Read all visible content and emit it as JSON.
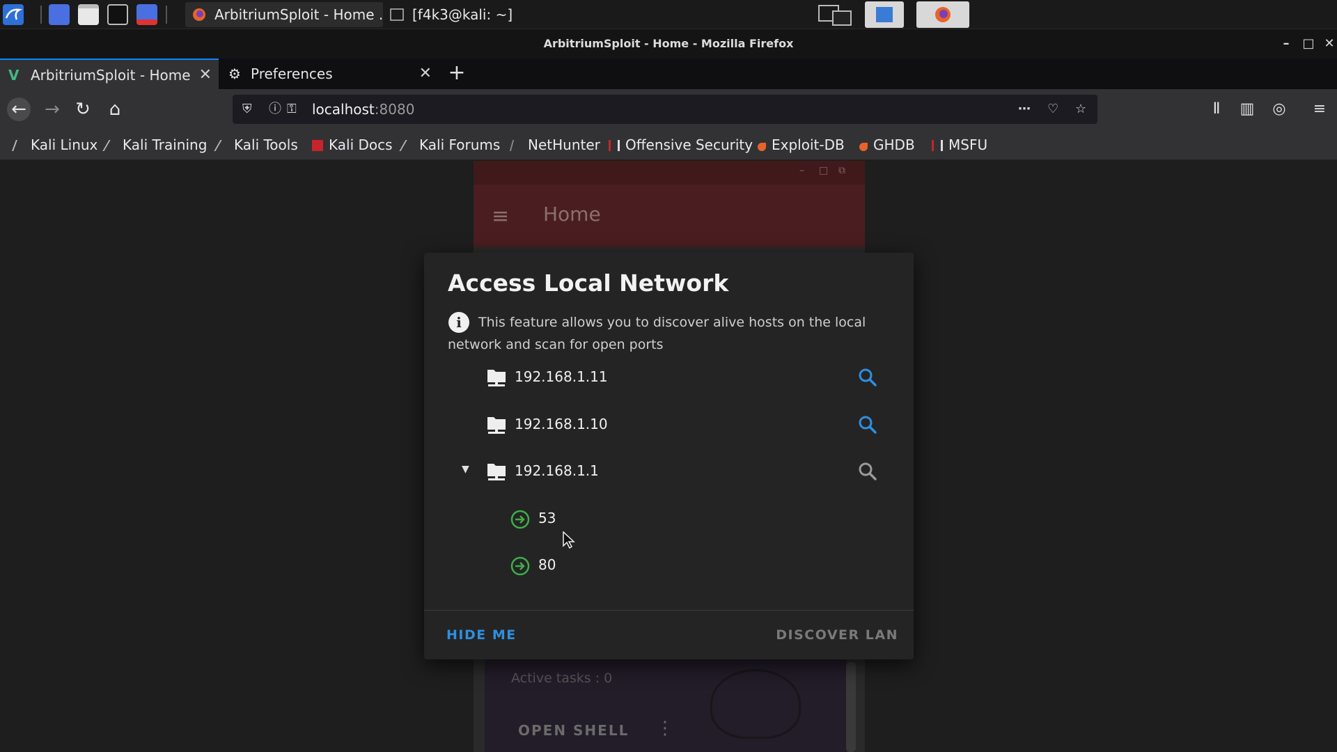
{
  "taskbar": {
    "tasks": [
      {
        "label": "ArbitriumSploit - Home ..."
      },
      {
        "label": "[f4k3@kali: ~]"
      }
    ]
  },
  "window": {
    "title": "ArbitriumSploit - Home - Mozilla Firefox"
  },
  "tabs": [
    {
      "label": "ArbitriumSploit - Home",
      "icon": "v-logo-icon",
      "active": true
    },
    {
      "label": "Preferences",
      "icon": "gear-icon",
      "active": false
    }
  ],
  "urlbar": {
    "host": "localhost",
    "port": ":8080"
  },
  "bookmarks": [
    {
      "label": "Kali Linux",
      "icon": "kali-dragon-icon"
    },
    {
      "label": "Kali Training",
      "icon": "kali-dragon-icon"
    },
    {
      "label": "Kali Tools",
      "icon": "kali-dragon-icon"
    },
    {
      "label": "Kali Docs",
      "icon": "kali-docs-icon"
    },
    {
      "label": "Kali Forums",
      "icon": "kali-dragon-icon"
    },
    {
      "label": "NetHunter",
      "icon": "nethunter-icon"
    },
    {
      "label": "Offensive Security",
      "icon": "offsec-icon"
    },
    {
      "label": "Exploit-DB",
      "icon": "exploitdb-icon"
    },
    {
      "label": "GHDB",
      "icon": "ghdb-icon"
    },
    {
      "label": "MSFU",
      "icon": "offsec-icon"
    }
  ],
  "background_app": {
    "header_title": "Home",
    "active_tasks": "Active tasks : 0",
    "open_shell": "OPEN SHELL"
  },
  "dialog": {
    "title": "Access Local Network",
    "description": "This feature allows you to discover alive hosts on the local network and scan for open ports",
    "hosts": [
      {
        "ip": "192.168.1.11",
        "expanded": false,
        "scan_color": "#2f8fe0"
      },
      {
        "ip": "192.168.1.10",
        "expanded": false,
        "scan_color": "#2f8fe0"
      },
      {
        "ip": "192.168.1.1",
        "expanded": true,
        "scan_color": "#9a9a9a"
      }
    ],
    "ports": [
      "53",
      "80"
    ],
    "hide_label": "HIDE ME",
    "discover_label": "DISCOVER LAN"
  },
  "colors": {
    "accent": "#2f8fe0",
    "port_icon": "#3fae49",
    "header_red": "#4a1e20"
  }
}
